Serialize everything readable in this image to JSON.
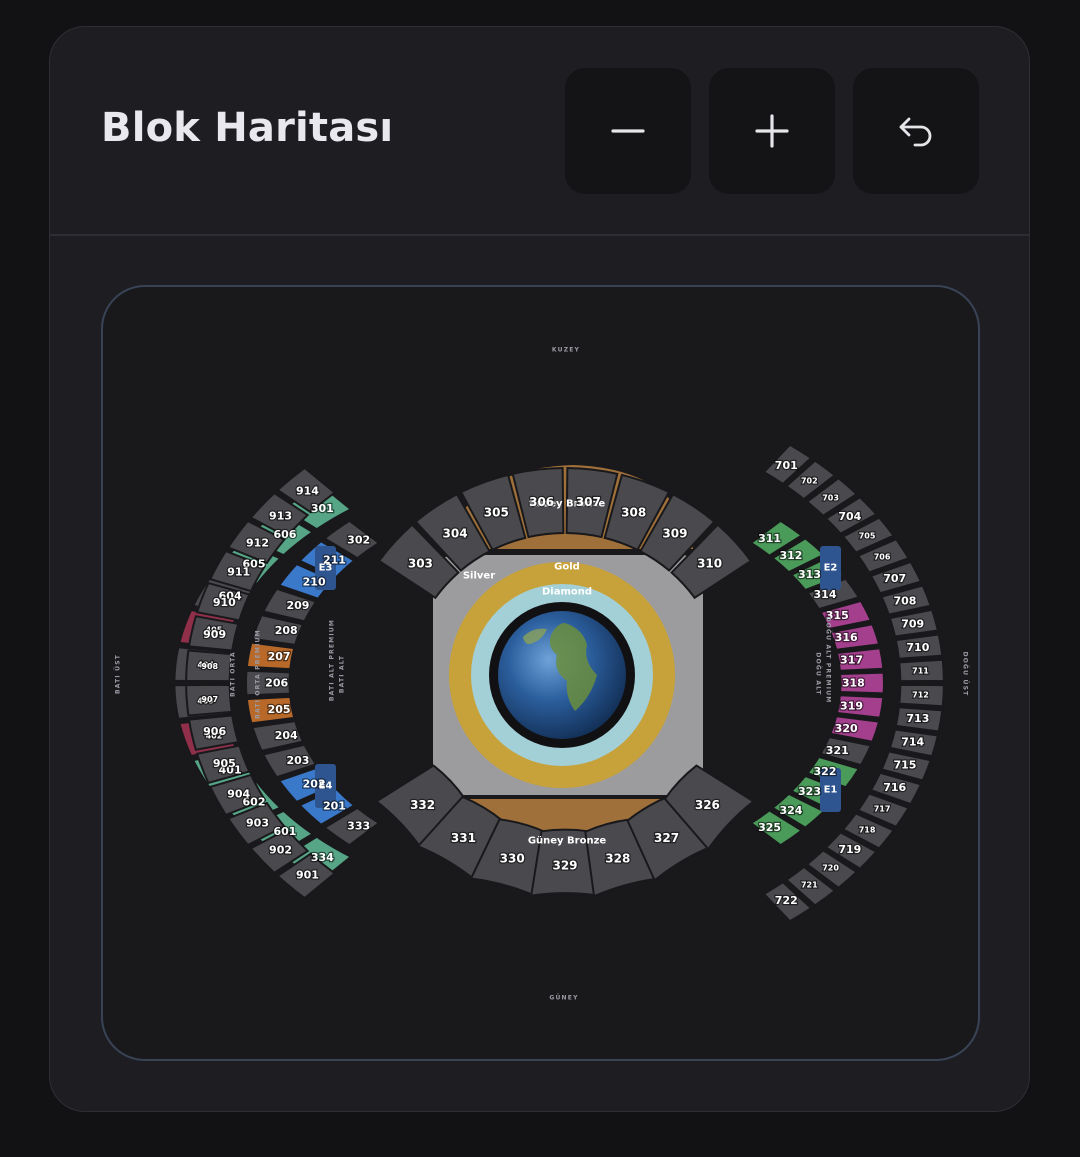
{
  "header": {
    "title": "Blok Haritası",
    "buttons": [
      {
        "name": "zoom-out-button",
        "icon": "minus-icon"
      },
      {
        "name": "zoom-in-button",
        "icon": "plus-icon"
      },
      {
        "name": "reset-view-button",
        "icon": "undo-icon"
      }
    ]
  },
  "colors": {
    "default": "#4a4a4e",
    "green": "#4a9a59",
    "teal": "#55a586",
    "blue": "#3a78c9",
    "orange": "#b8692a",
    "magenta": "#a33f8c",
    "crimson": "#8f2f4a",
    "navy": "#2f5590",
    "bronze": "#a0703a",
    "gold": "#c7a23a",
    "diamond": "#a3cfd6",
    "silver": "#9c9c9e"
  },
  "map": {
    "direction_labels": {
      "north": "KUZEY",
      "south": "GÜNEY"
    },
    "side_labels": {
      "bati_ust": "BATI ÜST",
      "bati_orta": "BATI ORTA",
      "bati_orta_premium": "BATI ORTA PREMIUM",
      "bati_alt_premium": "BATI ALT PREMIUM",
      "bati_alt": "BATI ALT",
      "dogu_alt_premium": "DOĞU ALT PREMIUM",
      "dogu_alt": "DOĞU ALT",
      "dogu_ust": "DOĞU ÜST"
    },
    "zones": {
      "kuzey_bronze": "Kuzey Bronze",
      "guney_bronze": "Güney Bronze",
      "silver": "Silver",
      "gold": "Gold",
      "diamond": "Diamond"
    },
    "entrances": [
      "E1",
      "E2",
      "E3",
      "E4"
    ],
    "north_ring": [
      {
        "id": "303",
        "c": "default"
      },
      {
        "id": "304",
        "c": "default"
      },
      {
        "id": "305",
        "c": "default"
      },
      {
        "id": "306",
        "c": "default"
      },
      {
        "id": "307",
        "c": "default"
      },
      {
        "id": "308",
        "c": "default"
      },
      {
        "id": "309",
        "c": "default"
      },
      {
        "id": "310",
        "c": "default"
      }
    ],
    "south_ring": [
      {
        "id": "332",
        "c": "default"
      },
      {
        "id": "331",
        "c": "default"
      },
      {
        "id": "330",
        "c": "default"
      },
      {
        "id": "329",
        "c": "default"
      },
      {
        "id": "328",
        "c": "default"
      },
      {
        "id": "327",
        "c": "default"
      },
      {
        "id": "326",
        "c": "default"
      }
    ],
    "east_lower": [
      {
        "id": "311",
        "c": "green"
      },
      {
        "id": "312",
        "c": "green"
      },
      {
        "id": "313",
        "c": "green"
      },
      {
        "id": "314",
        "c": "default"
      },
      {
        "id": "315",
        "c": "magenta"
      },
      {
        "id": "316",
        "c": "magenta"
      },
      {
        "id": "317",
        "c": "magenta"
      },
      {
        "id": "318",
        "c": "magenta"
      },
      {
        "id": "319",
        "c": "magenta"
      },
      {
        "id": "320",
        "c": "magenta"
      },
      {
        "id": "321",
        "c": "default"
      },
      {
        "id": "322",
        "c": "green"
      },
      {
        "id": "323",
        "c": "green"
      },
      {
        "id": "324",
        "c": "green"
      },
      {
        "id": "325",
        "c": "green"
      }
    ],
    "west_lower": [
      {
        "id": "302",
        "c": "default"
      },
      {
        "id": "211",
        "c": "blue"
      },
      {
        "id": "210",
        "c": "blue"
      },
      {
        "id": "209",
        "c": "default"
      },
      {
        "id": "208",
        "c": "default"
      },
      {
        "id": "207",
        "c": "orange"
      },
      {
        "id": "206",
        "c": "default"
      },
      {
        "id": "205",
        "c": "orange"
      },
      {
        "id": "204",
        "c": "default"
      },
      {
        "id": "203",
        "c": "default"
      },
      {
        "id": "202",
        "c": "blue"
      },
      {
        "id": "201",
        "c": "blue"
      },
      {
        "id": "333",
        "c": "default"
      }
    ],
    "west_middle": [
      {
        "id": "301",
        "c": "teal"
      },
      {
        "id": "606",
        "c": "teal"
      },
      {
        "id": "605",
        "c": "teal"
      },
      {
        "id": "604",
        "c": "default"
      },
      {
        "id": "405",
        "c": "crimson"
      },
      {
        "id": "404",
        "c": "default"
      },
      {
        "id": "403",
        "c": "default"
      },
      {
        "id": "402",
        "c": "crimson"
      },
      {
        "id": "401",
        "c": "teal"
      },
      {
        "id": "602",
        "c": "teal"
      },
      {
        "id": "601",
        "c": "teal"
      },
      {
        "id": "334",
        "c": "teal"
      }
    ],
    "west_upper": [
      {
        "id": "914",
        "c": "default"
      },
      {
        "id": "913",
        "c": "default"
      },
      {
        "id": "912",
        "c": "default"
      },
      {
        "id": "911",
        "c": "default"
      },
      {
        "id": "910",
        "c": "default"
      },
      {
        "id": "909",
        "c": "default"
      },
      {
        "id": "908",
        "c": "default"
      },
      {
        "id": "907",
        "c": "default"
      },
      {
        "id": "906",
        "c": "default"
      },
      {
        "id": "905",
        "c": "default"
      },
      {
        "id": "904",
        "c": "default"
      },
      {
        "id": "903",
        "c": "default"
      },
      {
        "id": "902",
        "c": "default"
      },
      {
        "id": "901",
        "c": "default"
      }
    ],
    "east_upper": [
      {
        "id": "701",
        "c": "default"
      },
      {
        "id": "702",
        "c": "default"
      },
      {
        "id": "703",
        "c": "default"
      },
      {
        "id": "704",
        "c": "default"
      },
      {
        "id": "705",
        "c": "default"
      },
      {
        "id": "706",
        "c": "default"
      },
      {
        "id": "707",
        "c": "default"
      },
      {
        "id": "708",
        "c": "default"
      },
      {
        "id": "709",
        "c": "default"
      },
      {
        "id": "710",
        "c": "default"
      },
      {
        "id": "711",
        "c": "default"
      },
      {
        "id": "712",
        "c": "default"
      },
      {
        "id": "713",
        "c": "default"
      },
      {
        "id": "714",
        "c": "default"
      },
      {
        "id": "715",
        "c": "default"
      },
      {
        "id": "716",
        "c": "default"
      },
      {
        "id": "717",
        "c": "default"
      },
      {
        "id": "718",
        "c": "default"
      },
      {
        "id": "719",
        "c": "default"
      },
      {
        "id": "720",
        "c": "default"
      },
      {
        "id": "721",
        "c": "default"
      },
      {
        "id": "722",
        "c": "default"
      }
    ]
  }
}
